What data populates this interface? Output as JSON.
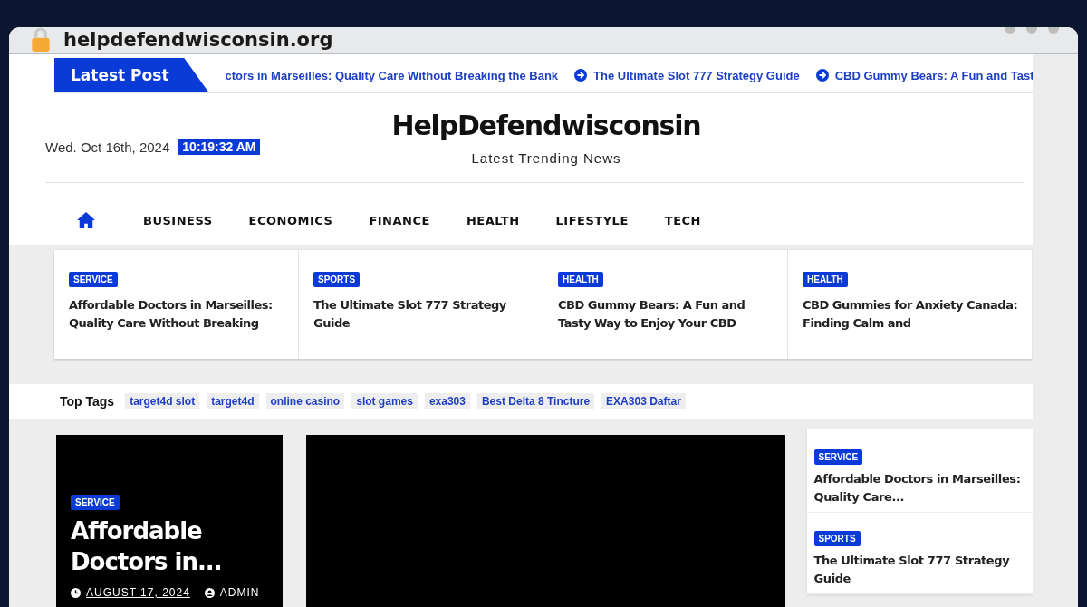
{
  "browser": {
    "url": "helpdefendwisconsin.org"
  },
  "ticker": {
    "label": "Latest Post",
    "items": [
      {
        "text": "ctors in Marseilles: Quality Care Without Breaking the Bank",
        "arrow_icon": false
      },
      {
        "text": "The Ultimate Slot 777 Strategy Guide",
        "arrow_icon": true
      },
      {
        "text": "CBD Gummy Bears: A Fun and Tast",
        "arrow_icon": true
      }
    ]
  },
  "header": {
    "date": "Wed. Oct 16th, 2024",
    "time": "10:19:32 AM",
    "site_title": "HelpDefendwisconsin",
    "tagline": "Latest Trending News"
  },
  "nav": {
    "items": [
      "BUSINESS",
      "ECONOMICS",
      "FINANCE",
      "HEALTH",
      "LIFESTYLE",
      "TECH"
    ]
  },
  "featured": [
    {
      "category": "SERVICE",
      "title": "Affordable Doctors in Marseilles: Quality Care Without Breaking"
    },
    {
      "category": "SPORTS",
      "title": "The Ultimate Slot 777 Strategy Guide"
    },
    {
      "category": "HEALTH",
      "title": "CBD Gummy Bears: A Fun and Tasty Way to Enjoy Your CBD"
    },
    {
      "category": "HEALTH",
      "title": "CBD Gummies for Anxiety Canada: Finding Calm and"
    }
  ],
  "tags": {
    "label": "Top Tags",
    "items": [
      "target4d slot",
      "target4d",
      "online casino",
      "slot games",
      "exa303",
      "Best Delta 8 Tincture",
      "EXA303 Daftar"
    ]
  },
  "hero": {
    "category": "SERVICE",
    "title": "Affordable Doctors in...",
    "date": "AUGUST 17, 2024",
    "author": "ADMIN"
  },
  "sidebar": [
    {
      "category": "SERVICE",
      "title": "Affordable Doctors in Marseilles: Quality Care..."
    },
    {
      "category": "SPORTS",
      "title": "The Ultimate Slot 777 Strategy Guide"
    }
  ]
}
